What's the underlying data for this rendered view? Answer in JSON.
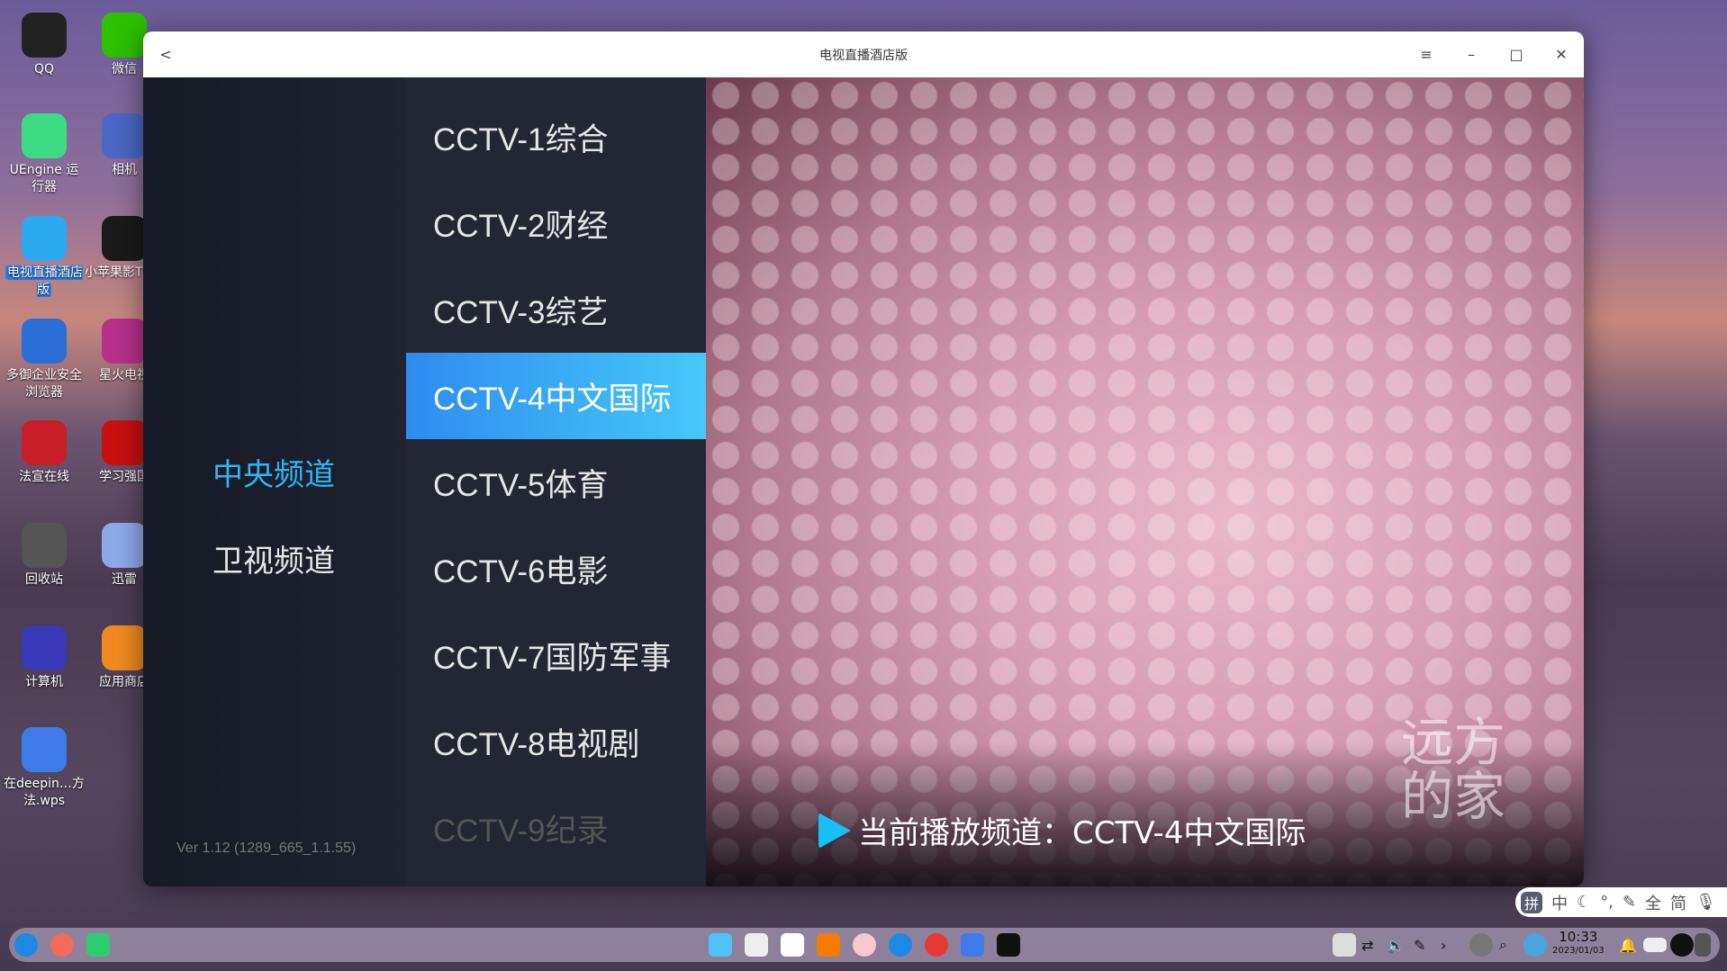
{
  "desktop": {
    "icons": [
      {
        "label": "QQ",
        "color": "#222"
      },
      {
        "label": "微信",
        "color": "#2dc100"
      },
      {
        "label": "UEngine 运行器",
        "color": "#3ddc84"
      },
      {
        "label": "相机",
        "color": "#4a67c4"
      },
      {
        "label": "电视直播酒店版",
        "color": "#2aa8f0"
      },
      {
        "label": "小苹果影TV版",
        "color": "#1a1a1a"
      },
      {
        "label": "多御企业安全浏览器",
        "color": "#2b6fd6"
      },
      {
        "label": "星火电视",
        "color": "#b8308a"
      },
      {
        "label": "法宣在线",
        "color": "#c81e28"
      },
      {
        "label": "学习强国",
        "color": "#c81010"
      },
      {
        "label": "回收站",
        "color": "#555"
      },
      {
        "label": "迅雷",
        "color": "#8fa9e8"
      },
      {
        "label": "计算机",
        "color": "#3a3ab8"
      },
      {
        "label": "应用商店",
        "color": "#f08a20"
      },
      {
        "label": "在deepin…方法.wps",
        "color": "#3e7be8"
      }
    ]
  },
  "window": {
    "title": "电视直播酒店版",
    "back": "<",
    "menu": "≡",
    "minimize": "–",
    "maximize": "□",
    "close": "✕"
  },
  "categories": [
    {
      "label": "中央频道",
      "active": true
    },
    {
      "label": "卫视频道",
      "active": false
    }
  ],
  "version": "Ver 1.12 (1289_665_1.1.55)",
  "channels": [
    "CCTV-1综合",
    "CCTV-2财经",
    "CCTV-3综艺",
    "CCTV-4中文国际",
    "CCTV-5体育",
    "CCTV-6电影",
    "CCTV-7国防军事",
    "CCTV-8电视剧",
    "CCTV-9纪录"
  ],
  "active_channel": 3,
  "now_playing": "当前播放频道：CCTV-4中文国际",
  "watermark": "远方的家",
  "ime": [
    "拼",
    "中",
    "☾",
    "°,",
    "✎",
    "全",
    "简",
    "🎙"
  ],
  "tray": {
    "time": "10:33",
    "date": "2023/01/03"
  },
  "colors": {
    "accent": "#2fb5f5",
    "play": "#18bff6"
  }
}
